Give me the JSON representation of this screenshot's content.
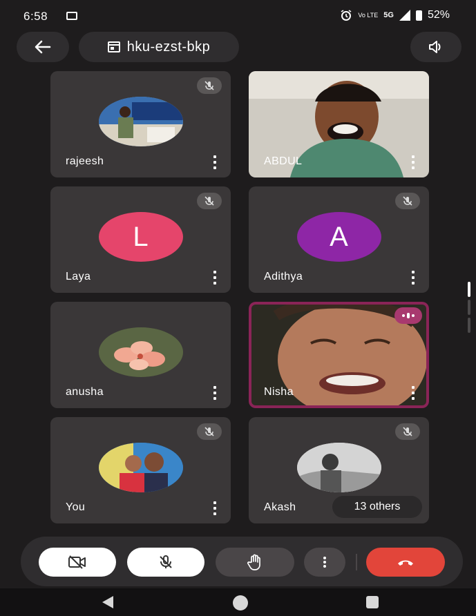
{
  "status_bar": {
    "time": "6:58",
    "network_small": "Vo LTE",
    "network": "5G",
    "battery": "52%"
  },
  "header": {
    "back_icon": "arrow-left-icon",
    "meeting_code": "hku-ezst-bkp",
    "speaker_icon": "speaker-icon"
  },
  "participants": [
    {
      "name": "rajeesh",
      "muted": true,
      "kind": "photo"
    },
    {
      "name": "ABDUL",
      "muted": false,
      "kind": "video"
    },
    {
      "name": "Laya",
      "muted": true,
      "kind": "letter",
      "letter": "L",
      "color": "#e5456b"
    },
    {
      "name": "Adithya",
      "muted": true,
      "kind": "letter",
      "letter": "A",
      "color": "#8e26a6"
    },
    {
      "name": "anusha",
      "muted": false,
      "kind": "photo"
    },
    {
      "name": "Nisha",
      "muted": false,
      "kind": "video",
      "speaking": true
    },
    {
      "name": "You",
      "muted": true,
      "kind": "photo"
    },
    {
      "name": "Akash",
      "muted": true,
      "kind": "photo",
      "others": "13 others"
    }
  ],
  "controls": {
    "camera": "camera-off-icon",
    "mic": "mic-off-icon",
    "hand": "raise-hand-icon",
    "more": "more-vert-icon",
    "end": "end-call-icon"
  },
  "colors": {
    "background": "#1e1c1d",
    "tile": "#3a3738",
    "end_call": "#e2453a",
    "speaking": "#8a2457"
  }
}
